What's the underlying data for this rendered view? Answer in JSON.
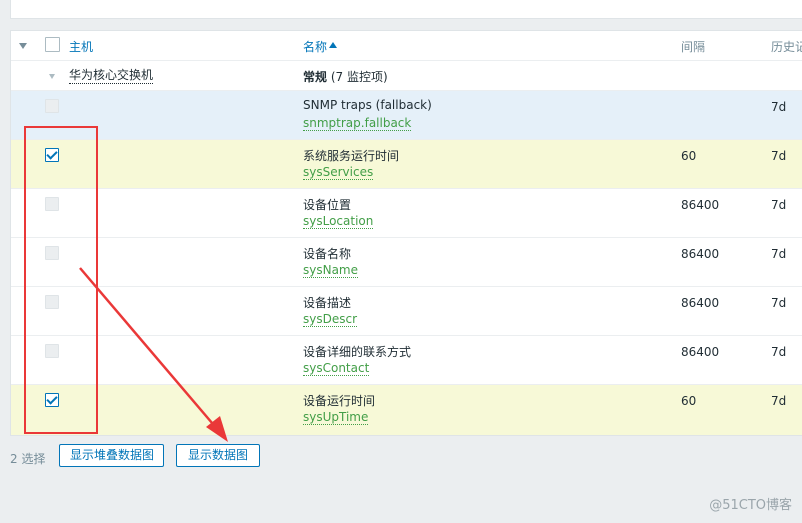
{
  "header": {
    "host": "主机",
    "name": "名称",
    "interval": "间隔",
    "history": "历史记"
  },
  "group": {
    "host": "华为核心交换机",
    "category": "常规",
    "count": "(7 监控项)"
  },
  "items": [
    {
      "name": "SNMP traps (fallback)",
      "key": "snmptrap.fallback",
      "interval": "",
      "history": "7d",
      "checked": false
    },
    {
      "name": "系统服务运行时间",
      "key": "sysServices",
      "interval": "60",
      "history": "7d",
      "checked": true
    },
    {
      "name": "设备位置",
      "key": "sysLocation",
      "interval": "86400",
      "history": "7d",
      "checked": false
    },
    {
      "name": "设备名称",
      "key": "sysName",
      "interval": "86400",
      "history": "7d",
      "checked": false
    },
    {
      "name": "设备描述",
      "key": "sysDescr",
      "interval": "86400",
      "history": "7d",
      "checked": false
    },
    {
      "name": "设备详细的联系方式",
      "key": "sysContact",
      "interval": "86400",
      "history": "7d",
      "checked": false
    },
    {
      "name": "设备运行时间",
      "key": "sysUpTime",
      "interval": "60",
      "history": "7d",
      "checked": true
    }
  ],
  "footer": {
    "selected": "2 选择",
    "stacked_graph_button": "显示堆叠数据图",
    "graph_button": "显示数据图"
  },
  "colors": {
    "link": "#0275b8",
    "item_key": "#429e47",
    "highlight_row": "#f7f9d7",
    "annotation": "#ea3838"
  },
  "watermark": "@51CTO博客"
}
